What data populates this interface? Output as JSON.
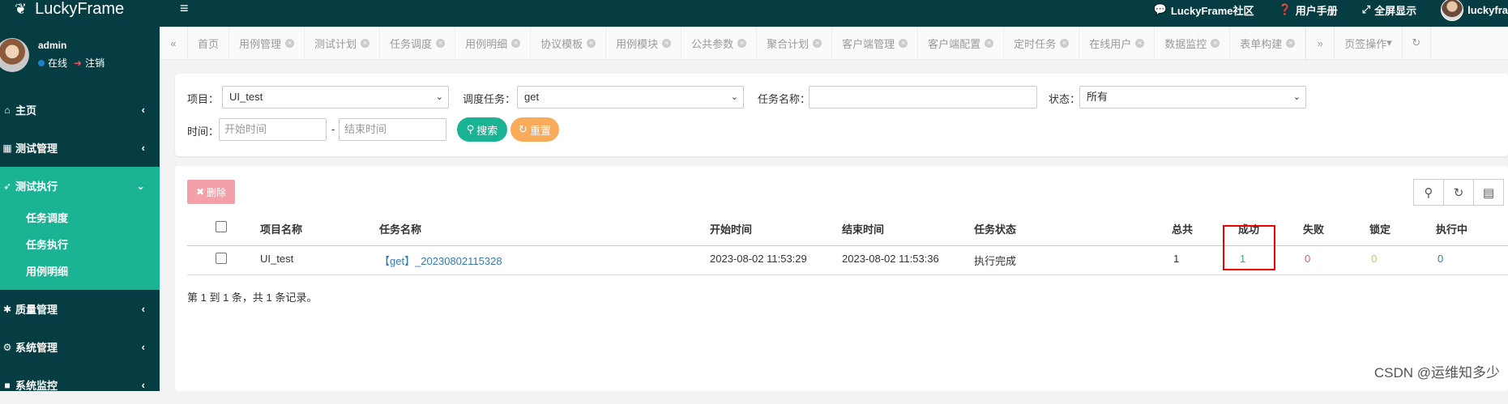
{
  "app": {
    "name": "LuckyFrame"
  },
  "topnav": {
    "community": "LuckyFrame社区",
    "manual": "用户手册",
    "fullscreen": "全屏显示",
    "user": "luckyfra"
  },
  "profile": {
    "name": "admin",
    "online": "在线",
    "logout": "注销"
  },
  "sidebar": {
    "items": [
      {
        "label": "主页",
        "icon": "home-icon"
      },
      {
        "label": "测试管理",
        "icon": "grid-icon"
      },
      {
        "label": "测试执行",
        "icon": "rocket-icon"
      },
      {
        "label": "质量管理",
        "icon": "bug-icon"
      },
      {
        "label": "系统管理",
        "icon": "gear-icon"
      },
      {
        "label": "系统监控",
        "icon": "video-icon"
      }
    ],
    "subitems": [
      "任务调度",
      "任务执行",
      "用例明细"
    ]
  },
  "tabs": [
    "首页",
    "用例管理",
    "测试计划",
    "任务调度",
    "用例明细",
    "协议模板",
    "用例模块",
    "公共参数",
    "聚合计划",
    "客户端管理",
    "客户端配置",
    "定时任务",
    "在线用户",
    "数据监控",
    "表单构建"
  ],
  "tabbar": {
    "page_ops": "页签操作"
  },
  "search": {
    "project_label": "项目：",
    "project_value": "UI_test",
    "task_label": "调度任务：",
    "task_value": "get",
    "taskname_label": "任务名称：",
    "status_label": "状态：",
    "status_value": "所有",
    "time_label": "时间：",
    "start_placeholder": "开始时间",
    "end_placeholder": "结束时间",
    "separator": "-",
    "search_btn": "搜索",
    "reset_btn": "重置"
  },
  "table": {
    "delete_btn": "删除",
    "headers": [
      "项目名称",
      "任务名称",
      "开始时间",
      "结束时间",
      "任务状态",
      "总共",
      "成功",
      "失败",
      "锁定",
      "执行中"
    ],
    "rows": [
      {
        "project": "UI_test",
        "task": "【get】_20230802115328",
        "start": "2023-08-02 11:53:29",
        "end": "2023-08-02 11:53:36",
        "status": "执行完成",
        "total": "1",
        "success": "1",
        "fail": "0",
        "locked": "0",
        "running": "0"
      }
    ],
    "summary": "第 1 到 1 条，共 1 条记录。"
  },
  "colors": {
    "sidebar": "#053d43",
    "accent": "#1ab394",
    "success": "#1ab394",
    "fail": "#ed5565",
    "locked": "#f8ac59",
    "running": "#1c84c6"
  },
  "watermark": "CSDN @运维知多少"
}
